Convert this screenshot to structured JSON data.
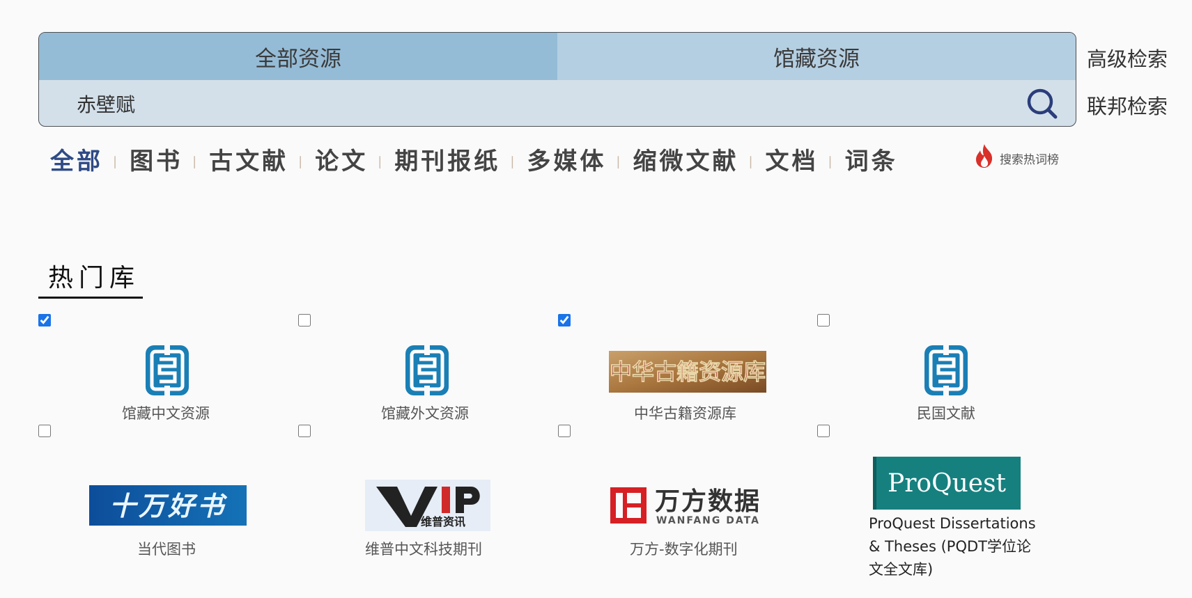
{
  "search": {
    "tabs": [
      {
        "label": "全部资源",
        "active": true
      },
      {
        "label": "馆藏资源",
        "active": false
      }
    ],
    "query": "赤壁赋",
    "advanced_label": "高级检索",
    "federated_label": "联邦检索"
  },
  "categories": {
    "items": [
      "全部",
      "图书",
      "古文献",
      "论文",
      "期刊报纸",
      "多媒体",
      "缩微文献",
      "文档",
      "词条"
    ],
    "active_index": 0,
    "hot_label": "搜索热词榜"
  },
  "popular": {
    "title": "热门库",
    "databases": [
      {
        "name": "馆藏中文资源",
        "checked": true,
        "logo": "nlc-logo"
      },
      {
        "name": "馆藏外文资源",
        "checked": false,
        "logo": "nlc-logo"
      },
      {
        "name": "中华古籍资源库",
        "checked": true,
        "logo": "zhonghua-guji-logo",
        "logo_text": "中华古籍资源库"
      },
      {
        "name": "民国文献",
        "checked": false,
        "logo": "nlc-logo"
      },
      {
        "name": "当代图书",
        "checked": false,
        "logo": "shiwan-haoshu-logo",
        "logo_text": "十万好书"
      },
      {
        "name": "维普中文科技期刊",
        "checked": false,
        "logo": "vip-logo",
        "logo_text": "VIP",
        "logo_sub": "维普资讯"
      },
      {
        "name": "万方-数字化期刊",
        "checked": false,
        "logo": "wanfang-logo",
        "logo_text": "万方数据",
        "logo_sub": "WANFANG DATA"
      },
      {
        "name": "ProQuest Dissertations & Theses (PQDT学位论文全文库)",
        "checked": false,
        "logo": "proquest-logo",
        "logo_text": "ProQuest"
      }
    ]
  },
  "colors": {
    "tab_active": "#95bcd6",
    "tab_inactive": "#b5cfe2",
    "query_bg": "#d3e0ea",
    "nlc_blue": "#1a7fb5",
    "hot_red": "#d9302a",
    "proquest_teal": "#16807f",
    "wanfang_red": "#d62024"
  }
}
